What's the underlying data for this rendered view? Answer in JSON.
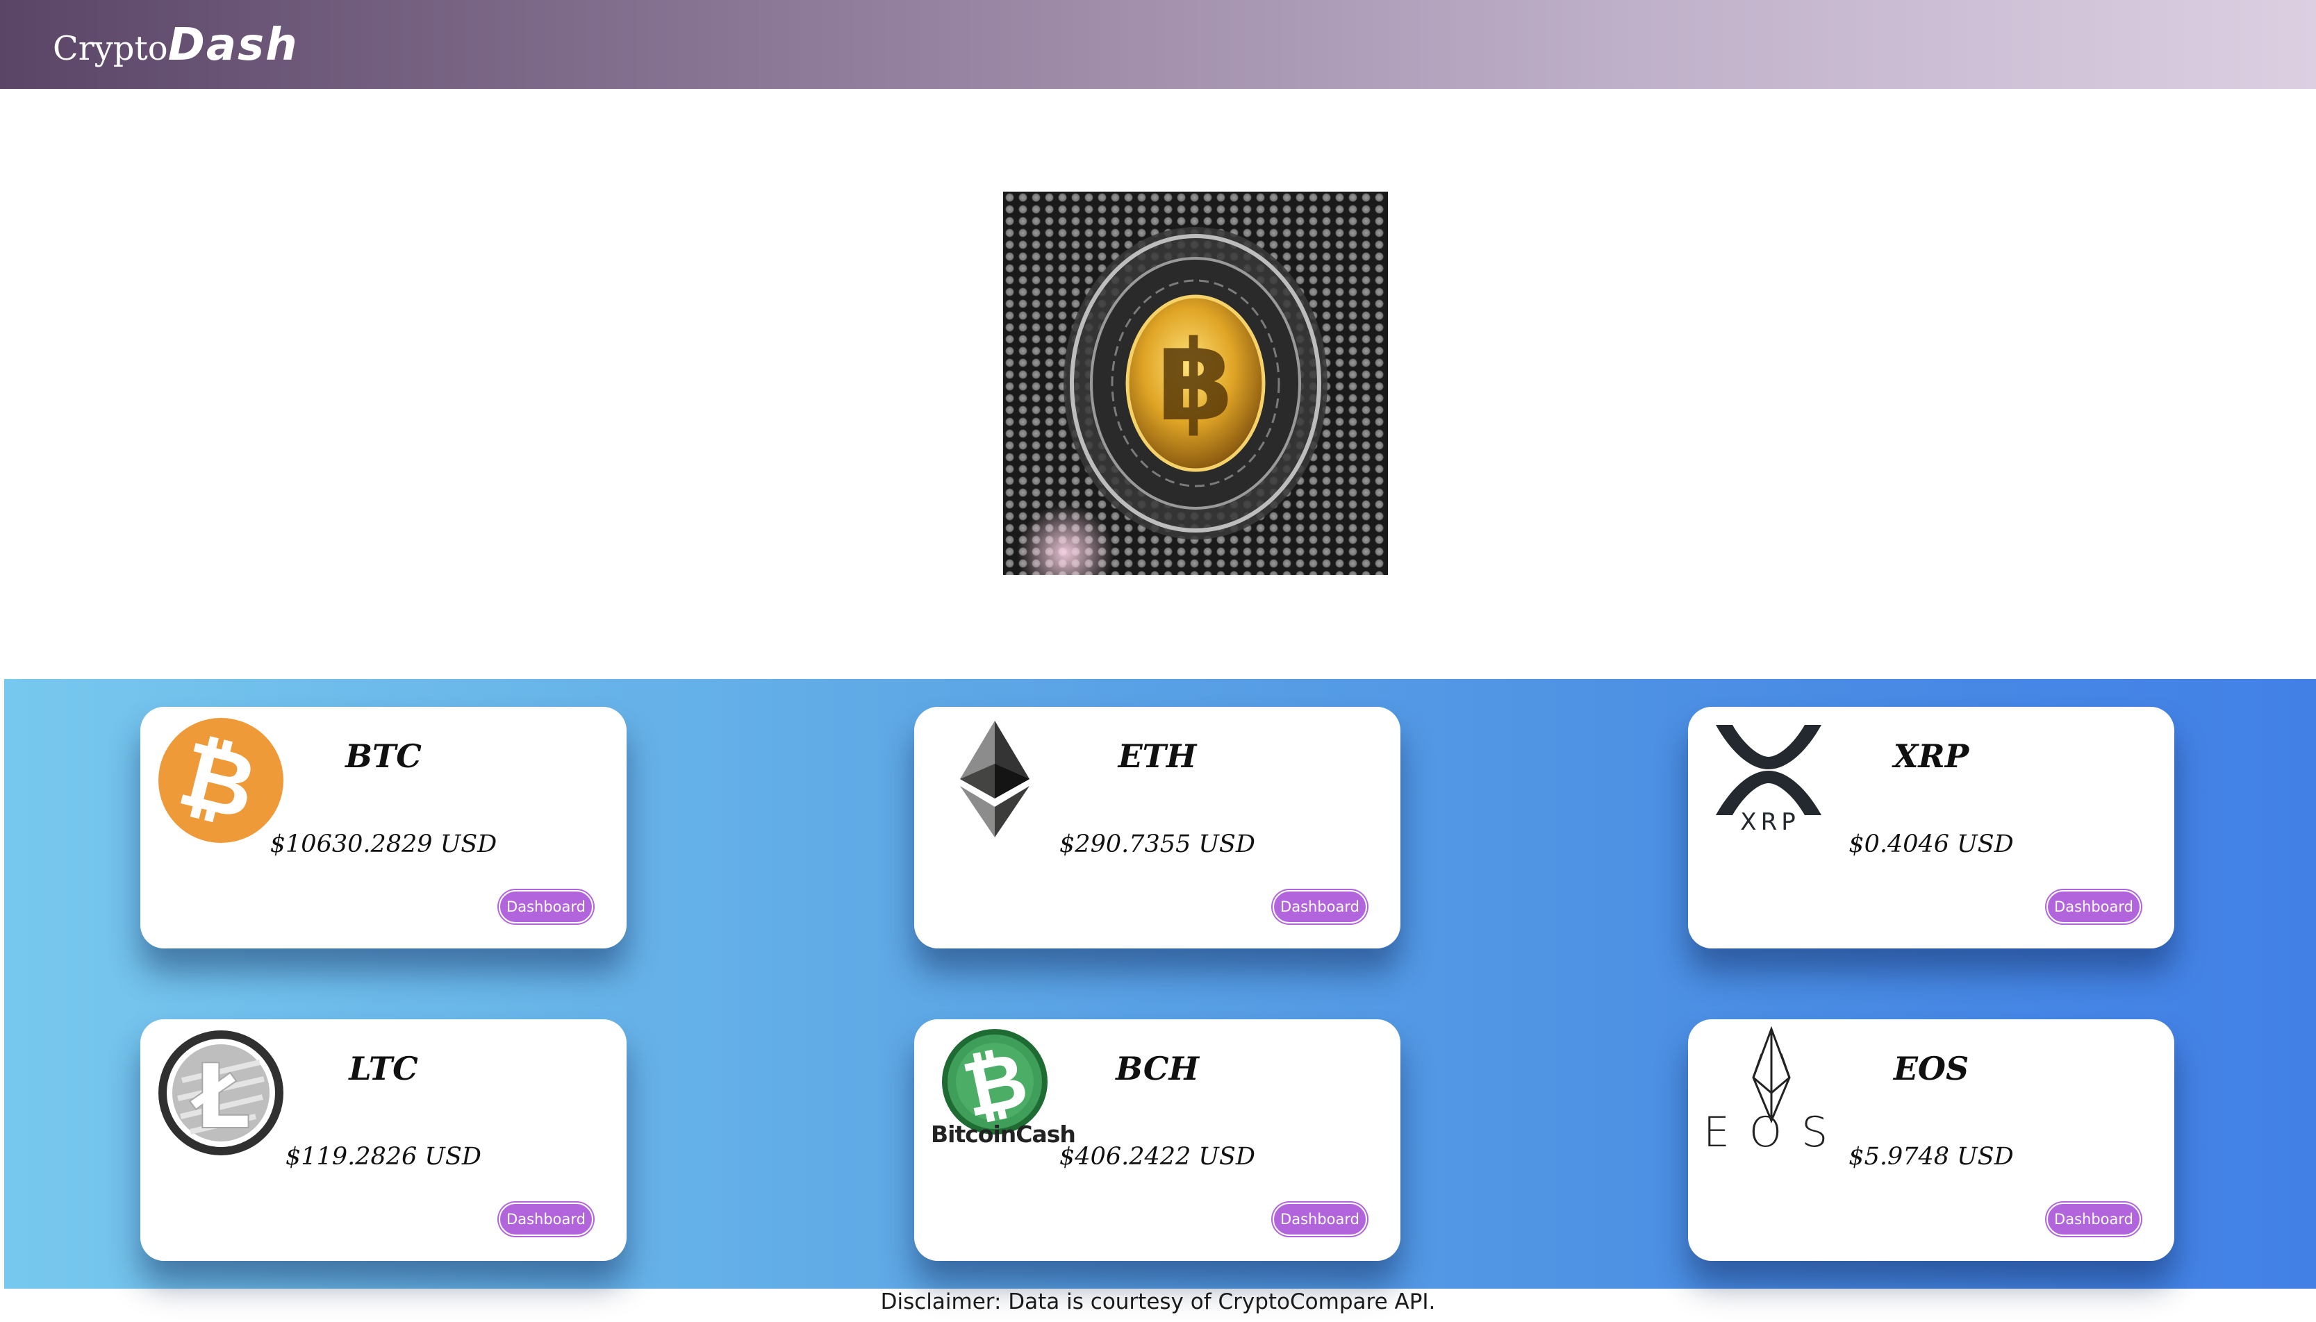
{
  "header": {
    "brand_part1": "Crypto",
    "brand_part2": "Dash",
    "background": "#7a6487"
  },
  "hero": {
    "icon": "bitcoin-hero-icon",
    "coin_color": "#e0a526"
  },
  "coins": [
    {
      "symbol": "BTC",
      "price": "$10630.2829 USD",
      "icon": "bitcoin-icon",
      "button_label": "Dashboard"
    },
    {
      "symbol": "ETH",
      "price": "$290.7355 USD",
      "icon": "ethereum-icon",
      "button_label": "Dashboard"
    },
    {
      "symbol": "XRP",
      "price": "$0.4046 USD",
      "icon": "xrp-icon",
      "button_label": "Dashboard",
      "logo_text": "XRP"
    },
    {
      "symbol": "LTC",
      "price": "$119.2826 USD",
      "icon": "litecoin-icon",
      "button_label": "Dashboard"
    },
    {
      "symbol": "BCH",
      "price": "$406.2422 USD",
      "icon": "bitcoin-cash-icon",
      "button_label": "Dashboard",
      "logo_text": "BitcoinCash"
    },
    {
      "symbol": "EOS",
      "price": "$5.9748 USD",
      "icon": "eos-icon",
      "button_label": "Dashboard",
      "logo_text": "EOS"
    }
  ],
  "colors": {
    "panel_gradient_start": "#77c8ee",
    "panel_gradient_end": "#4280e6",
    "button": "#b164dc",
    "btc_orange": "#ee9a39",
    "bch_green": "#3f9e5a"
  },
  "footer": {
    "disclaimer": "Disclaimer: Data is courtesy of CryptoCompare API."
  }
}
